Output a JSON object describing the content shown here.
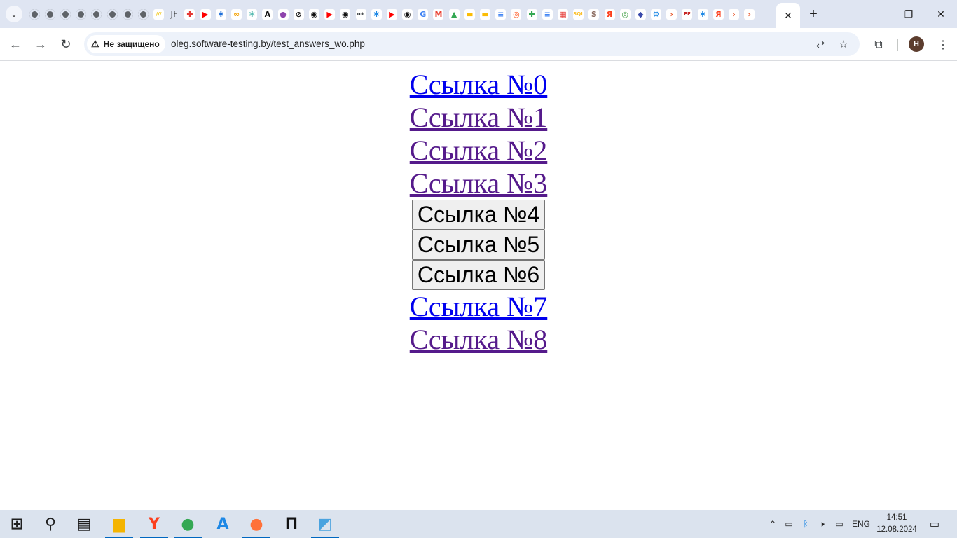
{
  "browser": {
    "tab_search_icon": "chevron-down-icon",
    "pinned_favicons": [
      {
        "glyph": "",
        "color": "#5f6368",
        "kind": "globe"
      },
      {
        "glyph": "",
        "color": "#5f6368",
        "kind": "globe"
      },
      {
        "glyph": "",
        "color": "#5f6368",
        "kind": "globe"
      },
      {
        "glyph": "",
        "color": "#5f6368",
        "kind": "globe"
      },
      {
        "glyph": "",
        "color": "#5f6368",
        "kind": "globe"
      },
      {
        "glyph": "",
        "color": "#5f6368",
        "kind": "globe"
      },
      {
        "glyph": "",
        "color": "#5f6368",
        "kind": "globe"
      },
      {
        "glyph": "",
        "color": "#5f6368",
        "kind": "globe"
      },
      {
        "glyph": "///",
        "color": "#f2c200",
        "kind": "app"
      },
      {
        "glyph": "JF",
        "color": "#1f1f1f",
        "kind": "text"
      },
      {
        "glyph": "✚",
        "color": "#e53935",
        "kind": "app"
      },
      {
        "glyph": "▶",
        "color": "#ff0000",
        "kind": "app"
      },
      {
        "glyph": "✱",
        "color": "#1e6fd9",
        "kind": "app"
      },
      {
        "glyph": "∞",
        "color": "#f4a100",
        "kind": "app"
      },
      {
        "glyph": "✻",
        "color": "#26a69a",
        "kind": "app"
      },
      {
        "glyph": "A",
        "color": "#111111",
        "kind": "app"
      },
      {
        "glyph": "●",
        "color": "#8e44ad",
        "kind": "app"
      },
      {
        "glyph": "⊘",
        "color": "#111111",
        "kind": "app"
      },
      {
        "glyph": "◉",
        "color": "#111111",
        "kind": "app"
      },
      {
        "glyph": "▶",
        "color": "#ff0000",
        "kind": "app"
      },
      {
        "glyph": "◉",
        "color": "#111111",
        "kind": "app"
      },
      {
        "glyph": "o+",
        "color": "#3c4043",
        "kind": "app"
      },
      {
        "glyph": "✱",
        "color": "#1e88e5",
        "kind": "app"
      },
      {
        "glyph": "▶",
        "color": "#ff0000",
        "kind": "app"
      },
      {
        "glyph": "◉",
        "color": "#111111",
        "kind": "app"
      },
      {
        "glyph": "G",
        "color": "#4285f4",
        "kind": "app"
      },
      {
        "glyph": "M",
        "color": "#ea4335",
        "kind": "app"
      },
      {
        "glyph": "▲",
        "color": "#34a853",
        "kind": "app"
      },
      {
        "glyph": "▬",
        "color": "#fbbc04",
        "kind": "app"
      },
      {
        "glyph": "▬",
        "color": "#fbbc04",
        "kind": "app"
      },
      {
        "glyph": "≡",
        "color": "#4285f4",
        "kind": "app"
      },
      {
        "glyph": "◎",
        "color": "#ff5722",
        "kind": "app"
      },
      {
        "glyph": "✚",
        "color": "#34a853",
        "kind": "app"
      },
      {
        "glyph": "≡",
        "color": "#4285f4",
        "kind": "app"
      },
      {
        "glyph": "▦",
        "color": "#e53935",
        "kind": "app"
      },
      {
        "glyph": "SQL",
        "color": "#fbc02d",
        "kind": "app"
      },
      {
        "glyph": "S",
        "color": "#8d6e63",
        "kind": "app"
      },
      {
        "glyph": "Я",
        "color": "#fc3f1d",
        "kind": "app"
      },
      {
        "glyph": "◎",
        "color": "#43a047",
        "kind": "app"
      },
      {
        "glyph": "◆",
        "color": "#3949ab",
        "kind": "app"
      },
      {
        "glyph": "⚙",
        "color": "#1e88e5",
        "kind": "app"
      },
      {
        "glyph": "›",
        "color": "#e64a19",
        "kind": "app"
      },
      {
        "glyph": "FE",
        "color": "#c62828",
        "kind": "app"
      },
      {
        "glyph": "✱",
        "color": "#1e88e5",
        "kind": "app"
      },
      {
        "glyph": "Я",
        "color": "#fc3f1d",
        "kind": "app"
      },
      {
        "glyph": "›",
        "color": "#e64a19",
        "kind": "app"
      },
      {
        "glyph": "›",
        "color": "#e64a19",
        "kind": "app"
      }
    ],
    "active_tab_close_icon": "close-icon",
    "new_tab_glyph": "+",
    "window_controls": {
      "minimize": "—",
      "restore": "❐",
      "close": "✕"
    },
    "toolbar": {
      "back_glyph": "←",
      "forward_glyph": "→",
      "reload_glyph": "↻",
      "security_label": "Не защищено",
      "security_glyph": "⚠",
      "url": "oleg.software-testing.by/test_answers_wo.php",
      "translate_glyph": "⇄",
      "bookmark_glyph": "☆",
      "extensions_glyph": "⧉",
      "profile_initial": "H",
      "menu_glyph": "⋮"
    }
  },
  "page": {
    "items": [
      {
        "type": "link",
        "label": "Ссылка №0",
        "state": "unvisited"
      },
      {
        "type": "link",
        "label": "Ссылка №1",
        "state": "visited"
      },
      {
        "type": "link",
        "label": "Ссылка №2",
        "state": "visited"
      },
      {
        "type": "link",
        "label": "Ссылка №3",
        "state": "visited"
      },
      {
        "type": "button",
        "label": "Ссылка №4"
      },
      {
        "type": "button",
        "label": "Ссылка №5"
      },
      {
        "type": "button",
        "label": "Ссылка №6"
      },
      {
        "type": "link",
        "label": "Ссылка №7",
        "state": "unvisited"
      },
      {
        "type": "link",
        "label": "Ссылка №8",
        "state": "visited"
      }
    ]
  },
  "taskbar": {
    "apps": [
      {
        "name": "start",
        "glyph": "⊞",
        "color": "#1f1f1f",
        "active": false
      },
      {
        "name": "search",
        "glyph": "⚲",
        "color": "#1f1f1f",
        "active": false
      },
      {
        "name": "task-view",
        "glyph": "▤",
        "color": "#1f1f1f",
        "active": false
      },
      {
        "name": "file-explorer",
        "glyph": "▆",
        "color": "#f4b400",
        "active": true
      },
      {
        "name": "yandex-browser",
        "glyph": "Y",
        "color": "#fc3f1d",
        "active": true
      },
      {
        "name": "chrome",
        "glyph": "●",
        "color": "#34a853",
        "active": true
      },
      {
        "name": "app-store",
        "glyph": "A",
        "color": "#1e88e5",
        "active": false
      },
      {
        "name": "firefox",
        "glyph": "●",
        "color": "#ff7139",
        "active": true
      },
      {
        "name": "terminal",
        "glyph": "П",
        "color": "#111111",
        "active": false
      },
      {
        "name": "notes",
        "glyph": "◩",
        "color": "#4aa3df",
        "active": true
      }
    ],
    "tray": {
      "chevron": "⌃",
      "battery": "▭",
      "bluetooth": "ᛒ",
      "volume": "🕨",
      "network": "▭",
      "language": "ENG",
      "time": "14:51",
      "date": "12.08.2024",
      "notifications": "▭"
    }
  }
}
